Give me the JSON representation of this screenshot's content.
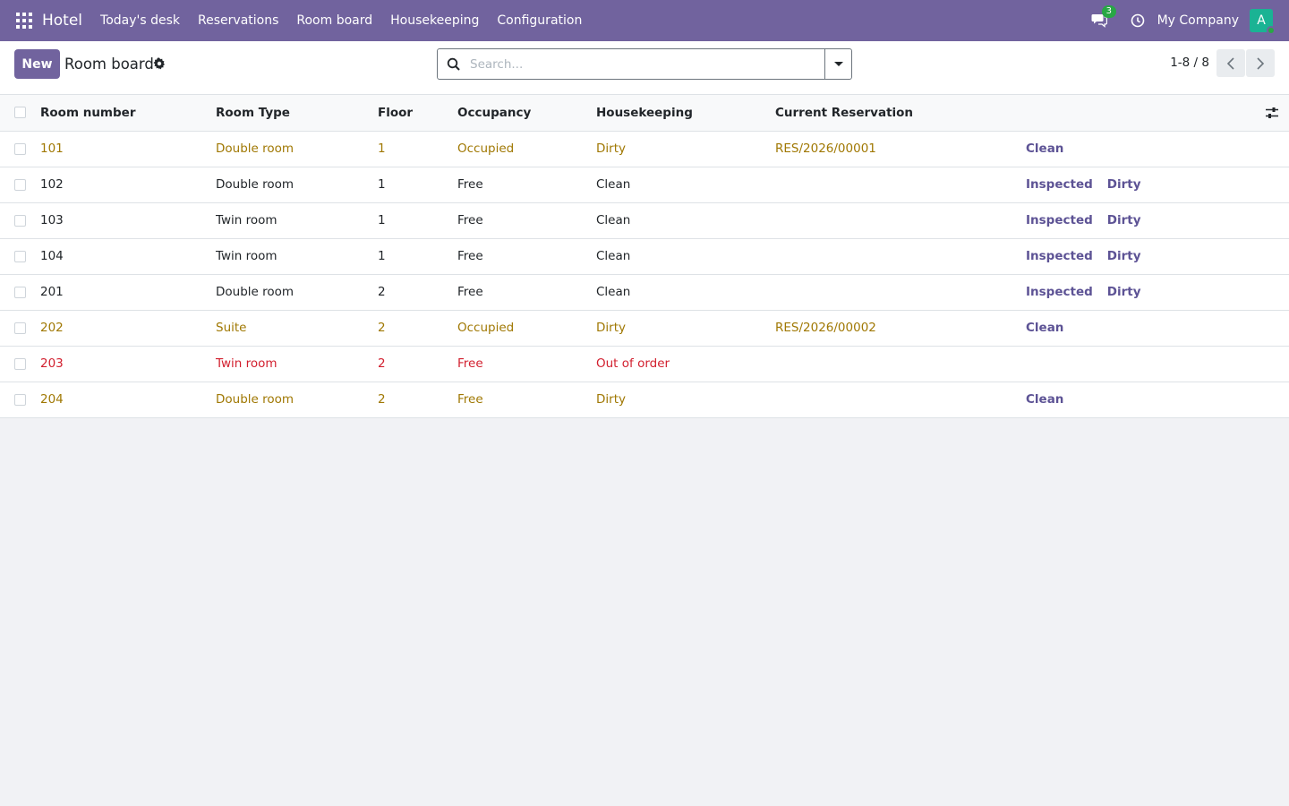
{
  "navbar": {
    "app_name": "Hotel",
    "menu": [
      "Today's desk",
      "Reservations",
      "Room board",
      "Housekeeping",
      "Configuration"
    ],
    "chat_count": "3",
    "company": "My Company",
    "avatar_initial": "A",
    "bar_color": "#71639e"
  },
  "control": {
    "new_label": "New",
    "title": "Room board",
    "search_placeholder": "Search...",
    "pager": "1-8 / 8"
  },
  "table": {
    "columns": [
      "Room number",
      "Room Type",
      "Floor",
      "Occupancy",
      "Housekeeping",
      "Current Reservation"
    ],
    "rows": [
      {
        "number": "101",
        "type": "Double room",
        "floor": "1",
        "occupancy": "Occupied",
        "housekeeping": "Dirty",
        "reservation": "RES/2026/00001",
        "style": "warning",
        "actions": [
          "Clean"
        ]
      },
      {
        "number": "102",
        "type": "Double room",
        "floor": "1",
        "occupancy": "Free",
        "housekeeping": "Clean",
        "reservation": "",
        "style": "normal",
        "actions": [
          "Inspected",
          "Dirty"
        ]
      },
      {
        "number": "103",
        "type": "Twin room",
        "floor": "1",
        "occupancy": "Free",
        "housekeeping": "Clean",
        "reservation": "",
        "style": "normal",
        "actions": [
          "Inspected",
          "Dirty"
        ]
      },
      {
        "number": "104",
        "type": "Twin room",
        "floor": "1",
        "occupancy": "Free",
        "housekeeping": "Clean",
        "reservation": "",
        "style": "normal",
        "actions": [
          "Inspected",
          "Dirty"
        ]
      },
      {
        "number": "201",
        "type": "Double room",
        "floor": "2",
        "occupancy": "Free",
        "housekeeping": "Clean",
        "reservation": "",
        "style": "normal",
        "actions": [
          "Inspected",
          "Dirty"
        ]
      },
      {
        "number": "202",
        "type": "Suite",
        "floor": "2",
        "occupancy": "Occupied",
        "housekeeping": "Dirty",
        "reservation": "RES/2026/00002",
        "style": "warning",
        "actions": [
          "Clean"
        ]
      },
      {
        "number": "203",
        "type": "Twin room",
        "floor": "2",
        "occupancy": "Free",
        "housekeeping": "Out of order",
        "reservation": "",
        "style": "danger",
        "actions": []
      },
      {
        "number": "204",
        "type": "Double room",
        "floor": "2",
        "occupancy": "Free",
        "housekeeping": "Dirty",
        "reservation": "",
        "style": "warning",
        "actions": [
          "Clean"
        ]
      }
    ]
  },
  "colors": {
    "warning": "#a07803",
    "danger": "#d2202f",
    "action": "#5d5395"
  }
}
